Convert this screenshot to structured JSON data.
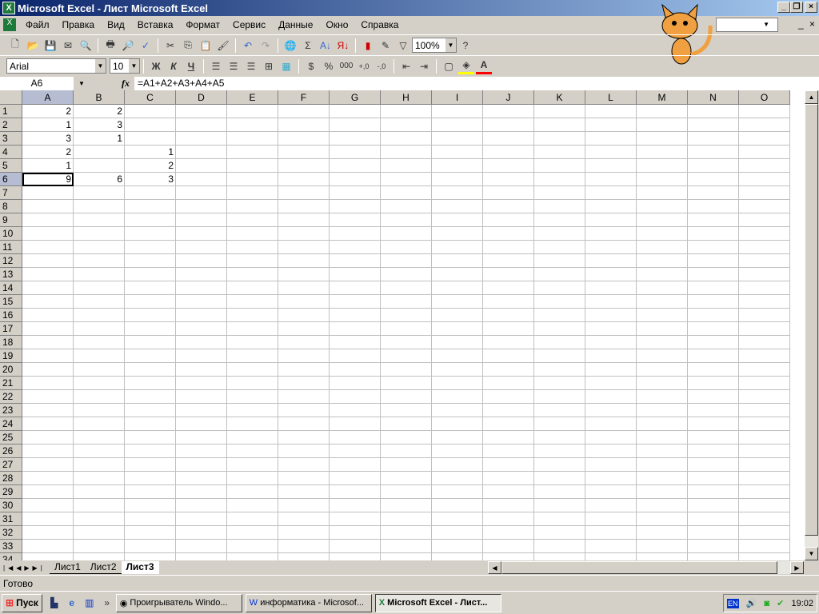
{
  "title": "Microsoft Excel - Лист Microsoft Excel",
  "menu": [
    "Файл",
    "Правка",
    "Вид",
    "Вставка",
    "Формат",
    "Сервис",
    "Данные",
    "Окно",
    "Справка"
  ],
  "toolbar": {
    "zoom": "100%",
    "font": "Arial",
    "size": "10",
    "bold": "Ж",
    "italic": "К",
    "underline": "Ч",
    "percent": "%",
    "thousands": "000",
    "sum": "Σ"
  },
  "formula": {
    "name_box": "A6",
    "fx": "fx",
    "value": "=A1+A2+A3+A4+A5"
  },
  "columns": [
    "A",
    "B",
    "C",
    "D",
    "E",
    "F",
    "G",
    "H",
    "I",
    "J",
    "K",
    "L",
    "M",
    "N",
    "O"
  ],
  "row_count": 34,
  "cells": {
    "A1": "2",
    "B1": "2",
    "A2": "1",
    "B2": "3",
    "A3": "3",
    "B3": "1",
    "A4": "2",
    "C4": "1",
    "A5": "1",
    "C5": "2",
    "A6": "9",
    "B6": "6",
    "C6": "3"
  },
  "active_cell": "A6",
  "sheets": [
    "Лист1",
    "Лист2",
    "Лист3"
  ],
  "active_sheet": "Лист3",
  "status": "Готово",
  "taskbar": {
    "start": "Пуск",
    "items": [
      "Проигрыватель Windo...",
      "информатика - Microsof...",
      "Microsoft Excel - Лист..."
    ],
    "lang": "EN",
    "clock": "19:02"
  }
}
